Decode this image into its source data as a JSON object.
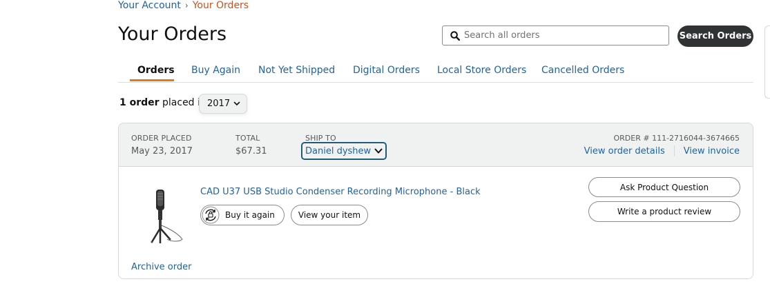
{
  "breadcrumb": {
    "parent": "Your Account",
    "separator": "›",
    "current": "Your Orders"
  },
  "page": {
    "title": "Your Orders"
  },
  "search": {
    "placeholder": "Search all orders",
    "button_label": "Search Orders"
  },
  "tabs": [
    {
      "label": "Orders",
      "active": true
    },
    {
      "label": "Buy Again"
    },
    {
      "label": "Not Yet Shipped"
    },
    {
      "label": "Digital Orders"
    },
    {
      "label": "Local Store Orders"
    },
    {
      "label": "Cancelled Orders"
    }
  ],
  "filter": {
    "count": "1 order",
    "suffix": "placed in",
    "year": "2017"
  },
  "order": {
    "placed_label": "Order placed",
    "placed_value": "May 23, 2017",
    "total_label": "Total",
    "total_value": "$67.31",
    "ship_to_label": "Ship to",
    "ship_to_value": "Daniel dyshew",
    "order_number": "Order # 111-2716044-3674665",
    "view_details": "View order details",
    "view_invoice": "View invoice",
    "item": {
      "title": "CAD U37 USB Studio Condenser Recording Microphone - Black",
      "image_icon": "microphone-on-tripod",
      "buy_again": "Buy it again",
      "view_item": "View your item"
    },
    "ask_question": "Ask Product Question",
    "write_review": "Write a product review",
    "archive": "Archive order"
  },
  "colors": {
    "link": "#2162A1",
    "accent": "#E47911",
    "dark_button": "#303333",
    "header_bg": "#F0F2F2",
    "focus_ring": "#1C5A7D"
  }
}
